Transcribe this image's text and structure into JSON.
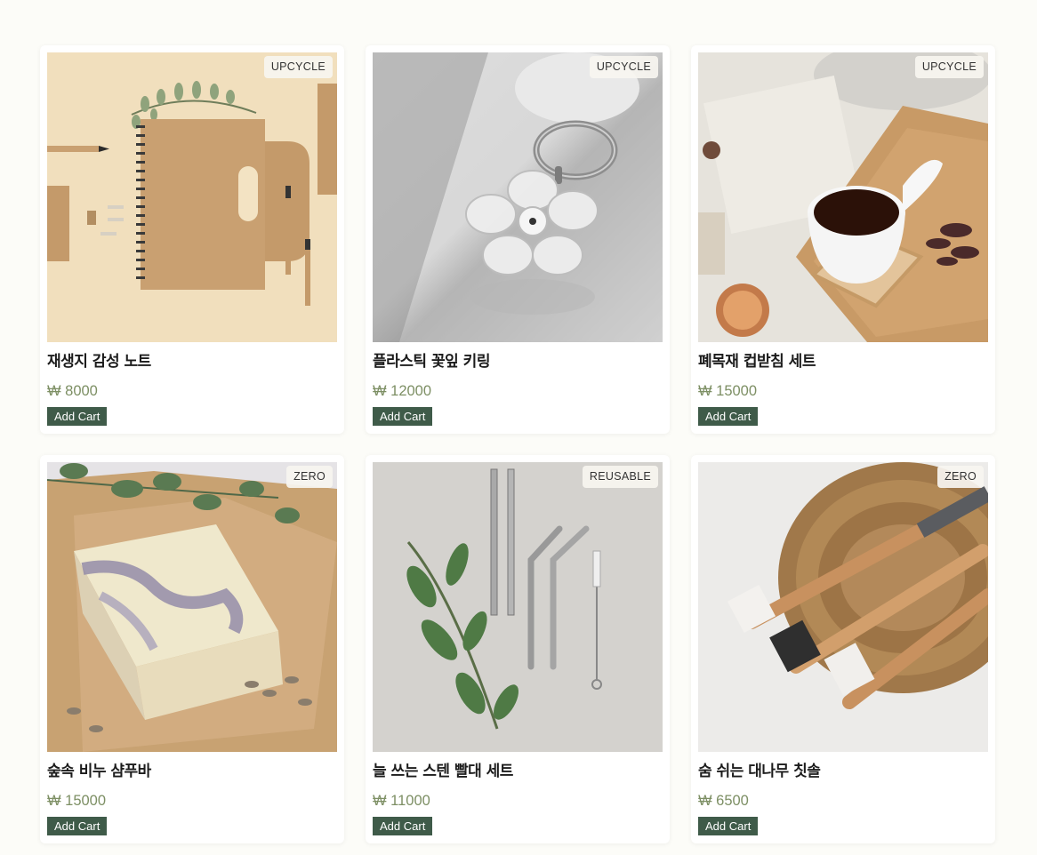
{
  "products": [
    {
      "name": "재생지 감성 노트",
      "price": "₩ 8000",
      "badge": "UPCYCLE",
      "button": "Add Cart",
      "image": "kraft-notebook-image"
    },
    {
      "name": "플라스틱 꽃잎 키링",
      "price": "₩ 12000",
      "badge": "UPCYCLE",
      "button": "Add Cart",
      "image": "flower-keyring-image"
    },
    {
      "name": "폐목재 컵받침 세트",
      "price": "₩ 15000",
      "badge": "UPCYCLE",
      "button": "Add Cart",
      "image": "wood-coaster-image"
    },
    {
      "name": "숲속 비누 샴푸바",
      "price": "₩ 15000",
      "badge": "ZERO",
      "button": "Add Cart",
      "image": "shampoo-bar-image"
    },
    {
      "name": "늘 쓰는 스텐 빨대 세트",
      "price": "₩ 11000",
      "badge": "REUSABLE",
      "button": "Add Cart",
      "image": "steel-straw-image"
    },
    {
      "name": "숨 쉬는 대나무 칫솔",
      "price": "₩ 6500",
      "badge": "ZERO",
      "button": "Add Cart",
      "image": "bamboo-toothbrush-image"
    }
  ],
  "colors": {
    "background": "#fcfcf8",
    "button": "#3f5b49",
    "price": "#7d8f64"
  }
}
